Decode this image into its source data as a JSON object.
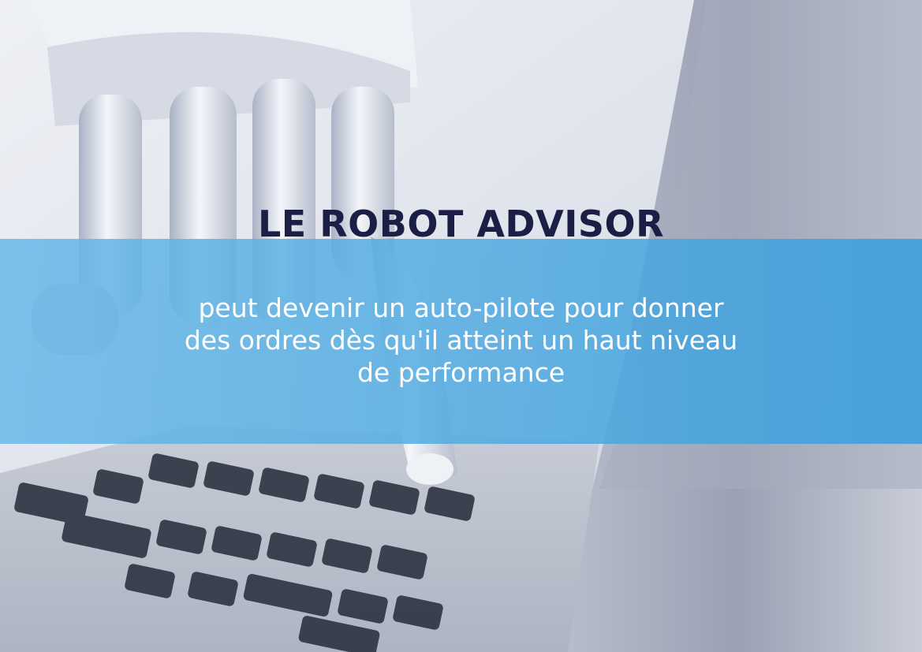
{
  "heading": "LE ROBOT ADVISOR",
  "subtitle_lines": [
    "peut devenir un auto-pilote pour donner",
    "des ordres dès qu'il atteint un haut niveau",
    "de performance"
  ],
  "keys": {
    "return": "return",
    "delete": "delete"
  },
  "colors": {
    "heading": "#1c1f45",
    "band": "#5ab0e4",
    "subtitle": "#ffffff"
  },
  "icons": [
    "robot-hand-image",
    "laptop-image",
    "keyboard-image"
  ]
}
